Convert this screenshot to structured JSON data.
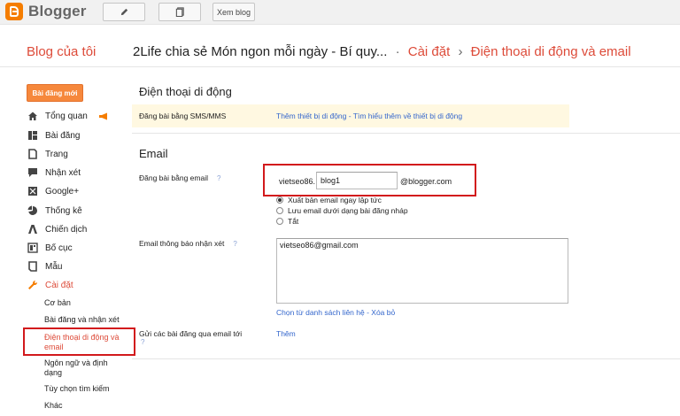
{
  "topbar": {
    "app_name": "Blogger",
    "view_blog_label": "Xem blog",
    "buttons": [
      "pencil-icon",
      "pages-icon"
    ]
  },
  "header": {
    "my_blogs": "Blog của tôi",
    "blog_name": "2Life chia sẻ Món ngon mỗi ngày - Bí quy...",
    "separator": "·",
    "crumb_settings": "Cài đặt",
    "crumb_arrow": "›",
    "crumb_mobile_email": "Điện thoại di động và email"
  },
  "sidebar": {
    "new_post": "Bài đăng mới",
    "items": [
      {
        "label": "Tổng quan",
        "icon": "home-icon"
      },
      {
        "label": "Bài đăng",
        "icon": "posts-icon"
      },
      {
        "label": "Trang",
        "icon": "page-icon"
      },
      {
        "label": "Nhận xét",
        "icon": "comment-icon"
      },
      {
        "label": "Google+",
        "icon": "google-plus-icon"
      },
      {
        "label": "Thống kê",
        "icon": "stats-icon"
      },
      {
        "label": "Chiến dịch",
        "icon": "campaign-icon"
      },
      {
        "label": "Bố cục",
        "icon": "layout-icon"
      },
      {
        "label": "Mẫu",
        "icon": "template-icon"
      },
      {
        "label": "Cài đặt",
        "icon": "wrench-icon"
      }
    ],
    "sub_items": [
      "Cơ bản",
      "Bài đăng và nhận xét",
      "Điện thoại di động và email",
      "Ngôn ngữ và định dạng",
      "Tùy chọn tìm kiếm",
      "Khác"
    ]
  },
  "mobile": {
    "title": "Điện thoại di động",
    "sms_label": "Đăng bài bằng SMS/MMS",
    "sms_link": "Thêm thiết bị di động - Tìm hiểu thêm về thiết bị di động"
  },
  "email": {
    "title": "Email",
    "post_by_email_label": "Đăng bài bằng email",
    "help": "?",
    "prefix": "vietseo86.",
    "input_value": "blog1",
    "suffix": "@blogger.com",
    "radio_options": [
      {
        "label": "Xuất bản email ngay lập tức",
        "checked": true
      },
      {
        "label": "Lưu email dưới dạng bài đăng nháp",
        "checked": false
      },
      {
        "label": "Tắt",
        "checked": false
      }
    ],
    "comment_notify_label": "Email thông báo nhận xét",
    "comment_notify_value": "vietseo86@gmail.com",
    "contacts_link": "Chọn từ danh sách liên hệ - Xóa bỏ",
    "send_posts_label": "Gửi các bài đăng qua email tới",
    "add_link": "Thêm"
  },
  "colors": {
    "accent": "#dd4b39",
    "highlight_box": "#d2191c",
    "new_post_button": "#f6883c",
    "link": "#3366cc"
  }
}
